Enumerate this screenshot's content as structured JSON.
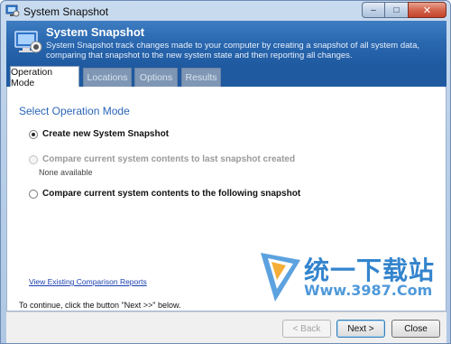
{
  "window": {
    "title": "System Snapshot",
    "controls": {
      "minimize": "–",
      "maximize": "□",
      "close": "✕"
    }
  },
  "header": {
    "title": "System Snapshot",
    "description": "System Snapshot track changes made to your computer by creating a snapshot of all system data, comparing that snapshot to the new system state and then reporting all changes."
  },
  "tabs": [
    {
      "label": "Operation Mode",
      "active": true
    },
    {
      "label": "Locations",
      "active": false
    },
    {
      "label": "Options",
      "active": false
    },
    {
      "label": "Results",
      "active": false
    }
  ],
  "content": {
    "section_title": "Select Operation Mode",
    "options": [
      {
        "label": "Create new System Snapshot",
        "selected": true,
        "enabled": true
      },
      {
        "label": "Compare current system contents to last snapshot created",
        "selected": false,
        "enabled": false
      },
      {
        "label": "Compare current system contents to the following snapshot",
        "selected": false,
        "enabled": true
      }
    ],
    "none_available": "None available",
    "reports_link": "View Existing Comparison Reports",
    "hint": "To continue, click the button \"Next >>\" below."
  },
  "watermark": {
    "text": "统一下载站",
    "url": "Www.3987.Com"
  },
  "footer": {
    "back_label": "< Back",
    "next_label": "Next >",
    "close_label": "Close"
  },
  "colors": {
    "accent": "#2a68b0",
    "link": "#1a3fb0",
    "section_title": "#2b66b8"
  }
}
